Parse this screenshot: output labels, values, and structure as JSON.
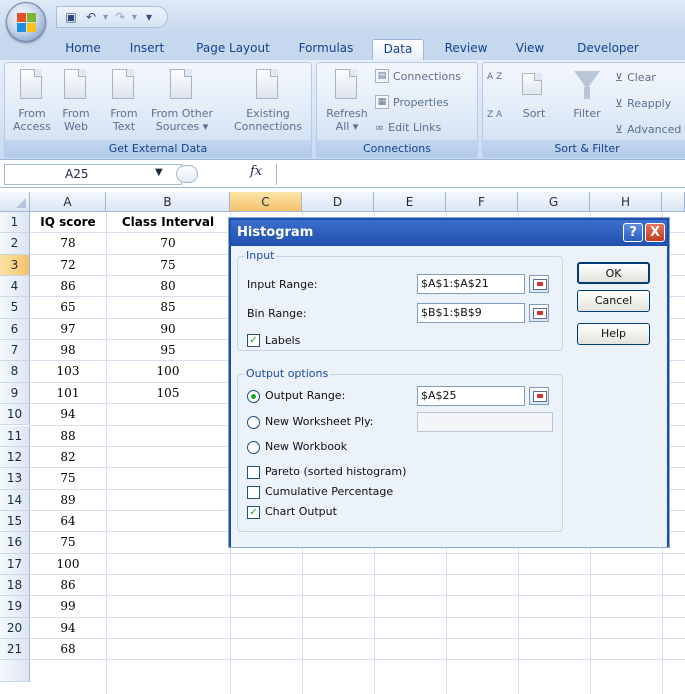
{
  "qat": {
    "icons": [
      "save-icon",
      "undo-icon",
      "redo-icon",
      "customize-icon"
    ]
  },
  "tabs": [
    "Home",
    "Insert",
    "Page Layout",
    "Formulas",
    "Data",
    "Review",
    "View",
    "Developer"
  ],
  "active_tab": "Data",
  "ribbon": {
    "get_external_data": {
      "label": "Get External Data",
      "buttons": [
        {
          "line1": "From",
          "line2": "Access"
        },
        {
          "line1": "From",
          "line2": "Web"
        },
        {
          "line1": "From",
          "line2": "Text"
        },
        {
          "line1": "From Other",
          "line2": "Sources ▾"
        },
        {
          "line1": "Existing",
          "line2": "Connections"
        }
      ]
    },
    "connections": {
      "label": "Connections",
      "refresh": {
        "line1": "Refresh",
        "line2": "All ▾"
      },
      "items": [
        "Connections",
        "Properties",
        "Edit Links"
      ]
    },
    "sort_filter": {
      "label": "Sort & Filter",
      "sort": "Sort",
      "filter": "Filter",
      "items": [
        "Clear",
        "Reapply",
        "Advanced"
      ],
      "az": "A Z",
      "za": "Z A"
    }
  },
  "formula_bar": {
    "name_box": "A25",
    "fx": "fx",
    "value": ""
  },
  "columns": [
    "A",
    "B",
    "C",
    "D",
    "E",
    "F",
    "G",
    "H"
  ],
  "selected_column": "C",
  "selected_row": "3",
  "rows": [
    "1",
    "2",
    "3",
    "4",
    "5",
    "6",
    "7",
    "8",
    "9",
    "10",
    "11",
    "12",
    "13",
    "14",
    "15",
    "16",
    "17",
    "18",
    "19",
    "20",
    "21"
  ],
  "sheet": {
    "A": [
      "IQ score",
      "78",
      "72",
      "86",
      "65",
      "97",
      "98",
      "103",
      "101",
      "94",
      "88",
      "82",
      "75",
      "89",
      "64",
      "75",
      "100",
      "86",
      "99",
      "94",
      "68"
    ],
    "B": [
      "Class Interval",
      "70",
      "75",
      "80",
      "85",
      "90",
      "95",
      "100",
      "105",
      "",
      "",
      "",
      "",
      "",
      "",
      "",
      "",
      "",
      "",
      "",
      ""
    ]
  },
  "dialog": {
    "title": "Histogram",
    "help_button": "?",
    "close_button": "X",
    "input_legend": "Input",
    "input_range_label": "Input Range:",
    "input_range_value": "$A$1:$A$21",
    "bin_range_label": "Bin Range:",
    "bin_range_value": "$B$1:$B$9",
    "labels_label": "Labels",
    "labels_checked": true,
    "output_legend": "Output options",
    "output_range_label": "Output Range:",
    "output_range_value": "$A$25",
    "new_ply_label": "New Worksheet Ply:",
    "new_ply_value": "",
    "new_workbook_label": "New Workbook",
    "pareto_label": "Pareto (sorted histogram)",
    "cumulative_label": "Cumulative Percentage",
    "chart_output_label": "Chart Output",
    "pareto_checked": false,
    "cumulative_checked": false,
    "chart_output_checked": true,
    "ok": "OK",
    "cancel": "Cancel",
    "help": "Help"
  }
}
